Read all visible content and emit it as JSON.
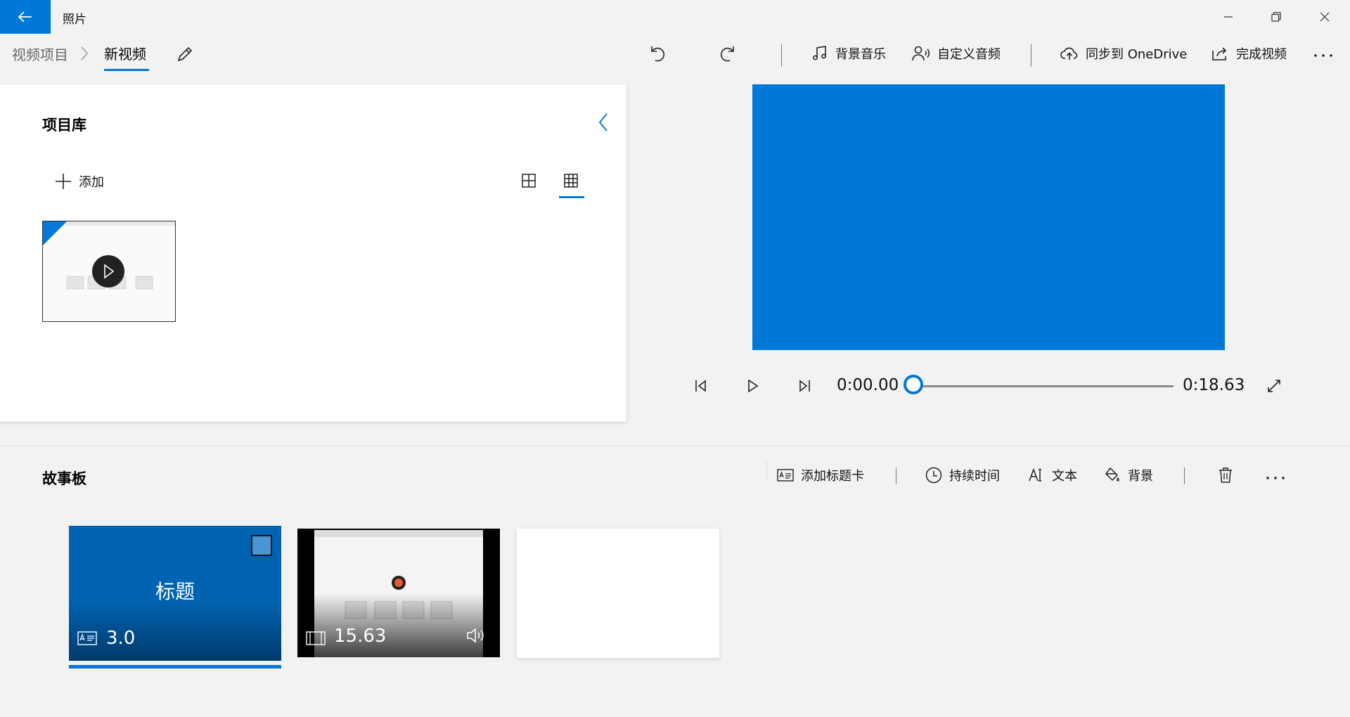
{
  "app": {
    "title": "照片"
  },
  "breadcrumb": {
    "root": "视频项目",
    "current": "新视频"
  },
  "toolbar": {
    "background_music": "背景音乐",
    "custom_audio": "自定义音频",
    "sync_onedrive": "同步到 OneDrive",
    "finish_video": "完成视频"
  },
  "library": {
    "title": "项目库",
    "add_label": "添加",
    "selected_view": "grid-small"
  },
  "player": {
    "current_time": "0:00.00",
    "total_time": "0:18.63",
    "progress": 0
  },
  "storyboard": {
    "title": "故事板",
    "actions": {
      "add_title_card": "添加标题卡",
      "duration": "持续时间",
      "text": "文本",
      "background": "背景"
    },
    "cards": [
      {
        "type": "title",
        "title_text": "标题",
        "duration": "3.0",
        "selected": true
      },
      {
        "type": "video",
        "duration": "15.63",
        "has_audio": true
      },
      {
        "type": "empty"
      }
    ]
  },
  "colors": {
    "accent": "#0078d7",
    "title_card": "#0063b1"
  }
}
